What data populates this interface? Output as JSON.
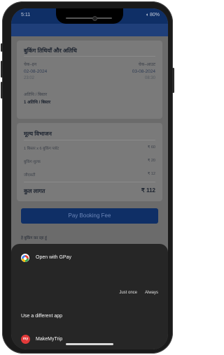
{
  "status_bar": {
    "time": "5:11",
    "right": "◖ 80%"
  },
  "booking_dates": {
    "title": "बुकिंग तिथियाँ और अतिथि",
    "checkin_label": "चेक–इन",
    "checkin_date": "02-08-2024",
    "checkin_time": "23:02",
    "checkout_label": "चेक–आउट",
    "checkout_date": "03-08-2024",
    "checkout_time": "08:30",
    "guests_label": "अतिथि / बिस्तर",
    "guests_value": "1 अतिथि / बिस्तर"
  },
  "price_breakdown": {
    "title": "मूल्य विभाजन",
    "rows": [
      {
        "label": "1 बिस्तर x 6 बुकिंग प्लॉट",
        "value": "₹ 60"
      },
      {
        "label": "बुकिंग शुल्क",
        "value": "₹ 20"
      },
      {
        "label": "जीएसटी",
        "value": "₹ 12"
      }
    ],
    "total_label": "कुल लागत",
    "total_value": "₹ 112"
  },
  "pay_button": "Pay Booking Fee",
  "booking_note": "हे बुकिंग कर रहा हूं",
  "sheet": {
    "open_with": "Open with GPay",
    "just_once": "Just once",
    "always": "Always",
    "different_app": "Use a different app",
    "app_name": "MakeMyTrip",
    "app_badge": "my"
  },
  "colors": {
    "brand_navy": "#0f2f66",
    "overlay_bg": "#6b6b6b",
    "sheet_bg": "#262626",
    "mmt_red": "#e23a3a"
  }
}
